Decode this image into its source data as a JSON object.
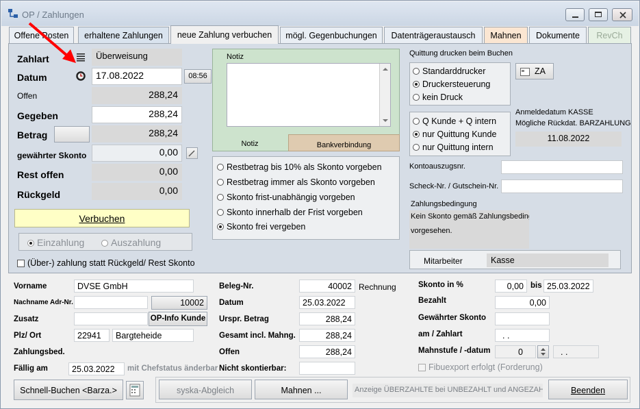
{
  "window": {
    "title": "OP / Zahlungen"
  },
  "tabs": [
    {
      "label": "Offene Posten"
    },
    {
      "label": "erhaltene Zahlungen"
    },
    {
      "label": "neue Zahlung verbuchen"
    },
    {
      "label": "mögl. Gegenbuchungen"
    },
    {
      "label": "Datenträgeraustausch"
    },
    {
      "label": "Mahnen"
    },
    {
      "label": "Dokumente"
    },
    {
      "label": "RevCh"
    }
  ],
  "colors": {
    "panel": "#d6dde6",
    "mahnen_tab": "#fbe6d2",
    "erhaltene_tab": "#d9e3ee",
    "revch_tab": "#e6f1e4",
    "notiz_box": "#cde3cd",
    "bank_tab": "#dfcbb0",
    "verbuchen_btn": "#ffffc6",
    "red_arrow": "#ff0000"
  },
  "form": {
    "zahlart_label": "Zahlart",
    "zahlart_value": "Überweisung",
    "datum_label": "Datum",
    "datum_value": "17.08.2022",
    "time_button": "08:56",
    "offen_label": "Offen",
    "offen_value": "288,24",
    "gegeben_label": "Gegeben",
    "gegeben_value": "288,24",
    "betrag_label": "Betrag",
    "betrag_value": "288,24",
    "skonto_label": "gewährter Skonto",
    "skonto_value": "0,00",
    "rest_label": "Rest offen",
    "rest_value": "0,00",
    "rueckgeld_label": "Rückgeld",
    "rueckgeld_value": "0,00",
    "verbuchen_button": "Verbuchen",
    "einzahlung": "Einzahlung",
    "auszahlung": "Auszahlung",
    "ueberzahlung_check": "(Über-) zahlung statt Rückgeld/ Rest Skonto"
  },
  "notiz": {
    "label": "Notiz",
    "tab_notiz": "Notiz",
    "tab_bank": "Bankverbindung"
  },
  "skonto_options": [
    {
      "label": "Restbetrag bis 10% als Skonto vorgeben",
      "selected": false
    },
    {
      "label": "Restbetrag immer als Skonto vorgeben",
      "selected": false
    },
    {
      "label": "Skonto frist-unabhängig vorgeben",
      "selected": false
    },
    {
      "label": "Skonto innerhalb der Frist vorgeben",
      "selected": false
    },
    {
      "label": "Skonto frei vergeben",
      "selected": true
    }
  ],
  "quittung": {
    "title": "Quittung drucken beim Buchen",
    "printers": [
      {
        "label": "Standarddrucker",
        "selected": false
      },
      {
        "label": "Druckersteuerung",
        "selected": true
      },
      {
        "label": "kein Druck",
        "selected": false
      }
    ],
    "za_button": "ZA",
    "types": [
      {
        "label": "Q Kunde + Q intern",
        "selected": false
      },
      {
        "label": "nur Quittung Kunde",
        "selected": true
      },
      {
        "label": "nur Quittung intern",
        "selected": false
      }
    ],
    "anmelde_line1": "Anmeldedatum KASSE",
    "anmelde_line2": "Mögliche Rückdat. BARZAHLUNG",
    "anmelde_date": "11.08.2022"
  },
  "right": {
    "konto_label": "Kontoauszugsnr.",
    "scheck_label": "Scheck-Nr. / Gutschein-Nr.",
    "zb_label": "Zahlungsbedingung",
    "zb_line1": "Kein Skonto gemäß Zahlungsbeding",
    "zb_line2": "vorgesehen.",
    "mitarbeiter_label": "Mitarbeiter",
    "mitarbeiter_value": "Kasse"
  },
  "customer": {
    "vorname_label": "Vorname",
    "vorname_value": "DVSE GmbH",
    "nachname_label": "Nachname Adr-Nr.",
    "adr_nr": "10002",
    "zusatz_label": "Zusatz",
    "opinfo_button": "OP-Info Kunde",
    "plz_label": "Plz/ Ort",
    "plz_value": "22941",
    "ort_value": "Bargteheide",
    "zb_label": "Zahlungsbed.",
    "faellig_label": "Fällig am",
    "faellig_value": "25.03.2022",
    "chef_note": "mit Chefstatus änderbar"
  },
  "beleg": {
    "nr_label": "Beleg-Nr.",
    "nr_value": "40002",
    "nr_type": "Rechnung",
    "datum_label": "Datum",
    "datum_value": "25.03.2022",
    "urspr_label": "Urspr. Betrag",
    "urspr_value": "288,24",
    "gesamt_label": "Gesamt incl. Mahng.",
    "gesamt_value": "288,24",
    "offen_label": "Offen",
    "offen_value": "288,24",
    "nicht_label": "Nicht skontierbar:"
  },
  "skonto_info": {
    "pct_label": "Skonto in %",
    "pct_value": "0,00",
    "bis_label": "bis",
    "bis_value": "25.03.2022",
    "bezahlt_label": "Bezahlt",
    "bezahlt_value": "0,00",
    "gewaehrt_label": "Gewährter Skonto",
    "am_label": "am / Zahlart",
    "am_value": ". .",
    "mahnstufe_label": "Mahnstufe / -datum",
    "mahnstufe_value": "0",
    "mahndatum_value": ". .",
    "fibu_label": "Fibuexport erfolgt (Forderung)"
  },
  "footer": {
    "schnell_button": "Schnell-Buchen <Barza.>",
    "syska_button": "syska-Abgleich",
    "mahnen_button": "Mahnen ...",
    "anzeige_text": "Anzeige ÜBERZAHLTE bei UNBEZAHLT und ANGEZAHLT",
    "beenden_button": "Beenden"
  }
}
